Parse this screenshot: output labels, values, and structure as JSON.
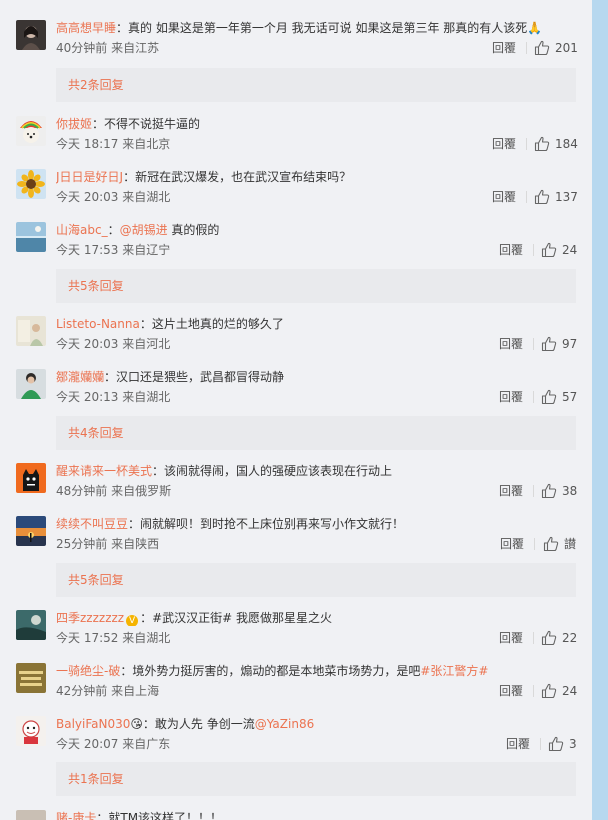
{
  "comments": [
    {
      "user": "高高想早睡",
      "sep": "：",
      "text": "真的 如果这是第一年第一个月 我无话可说 如果这是第三年 那真的有人该死🙏",
      "time": "40分钟前",
      "location": "来自江苏",
      "reply": "回覆",
      "likes": "201",
      "avatar": "dark-portrait"
    },
    {
      "user": "你拔姬",
      "sep": "：",
      "text": "不得不说挺牛逼的",
      "time": "今天 18:17",
      "location": "来自北京",
      "reply": "回覆",
      "likes": "184",
      "avatar": "rainbow-dog"
    },
    {
      "user": "J日日是好日J",
      "sep": "：",
      "text": "新冠在武汉爆发，也在武汉宣布结束吗？",
      "time": "今天 20:03",
      "location": "来自湖北",
      "reply": "回覆",
      "likes": "137",
      "avatar": "sunflower"
    },
    {
      "user": "山海abc_",
      "sep": "：",
      "text": "@胡锡进 真的假的",
      "mention": "@胡锡进",
      "mention_rest": " 真的假的",
      "time": "今天 17:53",
      "location": "来自辽宁",
      "reply": "回覆",
      "likes": "24",
      "avatar": "seascape"
    },
    {
      "user": "Listeto-Nanna",
      "sep": "：",
      "text": "这片土地真的烂的够久了",
      "time": "今天 20:03",
      "location": "来自河北",
      "reply": "回覆",
      "likes": "97",
      "avatar": "light-figure"
    },
    {
      "user": "鄒瀧孏孏",
      "sep": "：",
      "text": "汉口还是猥些，武昌都冒得动静",
      "time": "今天 20:13",
      "location": "来自湖北",
      "reply": "回覆",
      "likes": "57",
      "avatar": "green-person"
    },
    {
      "user": "醒来请来一杯美式",
      "sep": "：",
      "text": "该闹就得闹，国人的强硬应该表现在行动上",
      "time": "48分钟前",
      "location": "来自俄罗斯",
      "reply": "回覆",
      "likes": "38",
      "avatar": "black-cat"
    },
    {
      "user": "续续不叫豆豆",
      "sep": "：",
      "text": "闹就解呗！到时抢不上床位别再来写小作文就行！",
      "time": "25分钟前",
      "location": "来自陕西",
      "reply": "回覆",
      "likes": "讃",
      "avatar": "sunset"
    },
    {
      "user": "四季zzzzzzz",
      "sep": "：",
      "text": "#武汉汉正街# 我愿做那星星之火",
      "badge": "V",
      "time": "今天 17:52",
      "location": "来自湖北",
      "reply": "回覆",
      "likes": "22",
      "avatar": "teal-scene"
    },
    {
      "user": "一骑绝尘-破",
      "sep": "：",
      "text": "境外势力挺厉害的，煽动的都是本地菜市场势力，是吧",
      "tag": "#张江警方#",
      "time": "42分钟前",
      "location": "来自上海",
      "reply": "回覆",
      "likes": "24",
      "avatar": "golden-text"
    },
    {
      "user": "BalyiFaN030",
      "sep": "：",
      "text": "敢为人先 争创一流",
      "badge_emoji": "😘",
      "mention": "@YaZin86",
      "time": "今天 20:07",
      "location": "来自广东",
      "reply": "回覆",
      "likes": "3",
      "avatar": "red-cartoon"
    },
    {
      "user": "赌-康卡",
      "sep": "：",
      "text": "就TM该这样了！！！",
      "time": "",
      "location": "",
      "reply": "",
      "likes": "",
      "avatar": "partial"
    }
  ],
  "more_replies": [
    {
      "label": "共2条回复"
    },
    {
      "label": "共5条回复"
    },
    {
      "label": "共4条回复"
    },
    {
      "label": "共5条回复"
    },
    {
      "label": "共1条回复"
    }
  ],
  "colors": {
    "username": "#eb7350",
    "background": "#f0f1f4",
    "more_box": "#e9eaed",
    "scrollbar": "#b7d8ef"
  },
  "icons": {
    "like": "thumbs-up-icon"
  }
}
